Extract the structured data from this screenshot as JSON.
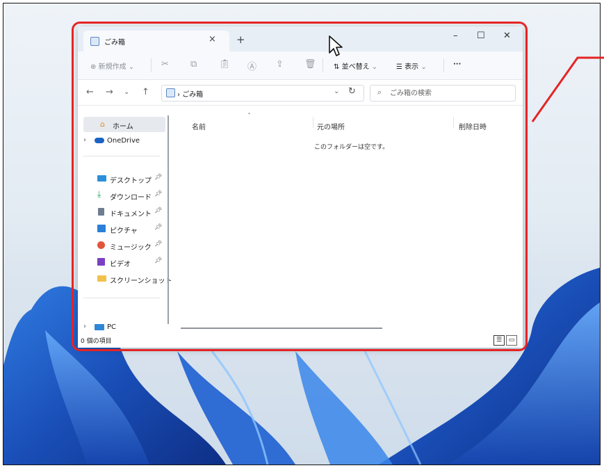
{
  "window": {
    "tab_title": "ごみ箱",
    "tab_close": "×",
    "new_tab": "+",
    "minimize": "–",
    "maximize": "☐",
    "close": "✕"
  },
  "toolbar": {
    "new": "新規作成",
    "sort": "並べ替え",
    "view": "表示",
    "more": "···"
  },
  "address": {
    "path": "ごみ箱",
    "search_placeholder": "ごみ箱の検索"
  },
  "sidebar": {
    "home": "ホーム",
    "onedrive": "OneDrive",
    "quick": [
      {
        "label": "デスクトップ",
        "icon": "desktop-icon"
      },
      {
        "label": "ダウンロード",
        "icon": "download-icon"
      },
      {
        "label": "ドキュメント",
        "icon": "document-icon"
      },
      {
        "label": "ピクチャ",
        "icon": "picture-icon"
      },
      {
        "label": "ミュージック",
        "icon": "music-icon"
      },
      {
        "label": "ビデオ",
        "icon": "video-icon"
      },
      {
        "label": "スクリーンショット",
        "icon": "folder-icon"
      }
    ],
    "pc": "PC"
  },
  "content": {
    "columns": [
      "名前",
      "元の場所",
      "削除日時"
    ],
    "empty_message": "このフォルダーは空です。"
  },
  "status": {
    "count": "0 個の項目"
  },
  "colors": {
    "highlight": "#e52424",
    "accent": "#1a73e8"
  }
}
